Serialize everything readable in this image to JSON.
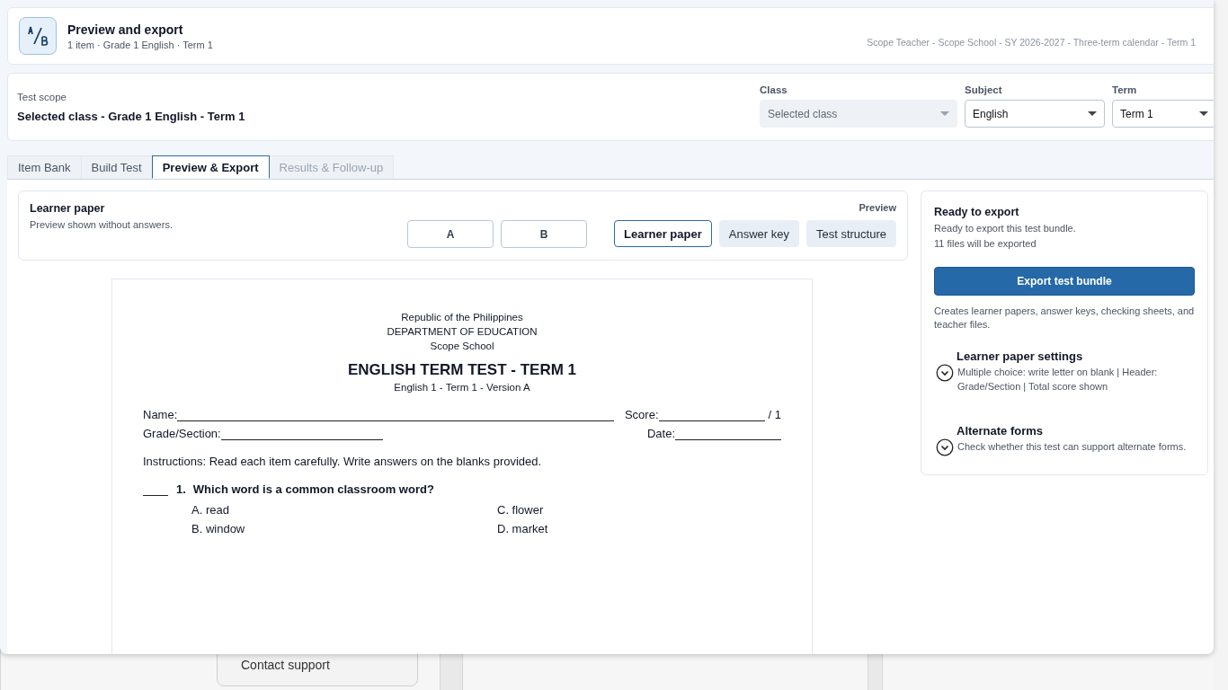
{
  "background": {
    "texts": [
      {
        "kind": "button",
        "text": "Contact support"
      }
    ]
  },
  "header": {
    "title": "Preview and export",
    "subtitle": "1 item · Grade 1 English · Term 1",
    "context": "Scope Teacher - Scope School - SY 2026-2027 - Three-term calendar - Term 1"
  },
  "scope": {
    "label": "Test scope",
    "value": "Selected class - Grade 1 English - Term 1",
    "fields": [
      {
        "label": "Class",
        "value": "Selected class",
        "disabled": true
      },
      {
        "label": "Subject",
        "value": "English",
        "disabled": false
      },
      {
        "label": "Term",
        "value": "Term 1",
        "disabled": false
      }
    ]
  },
  "tabs": [
    {
      "label": "Item Bank",
      "selected": false,
      "disabled": false
    },
    {
      "label": "Build Test",
      "selected": false,
      "disabled": false
    },
    {
      "label": "Preview & Export",
      "selected": true,
      "disabled": false
    },
    {
      "label": "Results & Follow-up",
      "selected": false,
      "disabled": true
    }
  ],
  "preview_bar": {
    "title": "Learner paper",
    "description": "Preview shown without answers.",
    "mode_label": "Preview",
    "versions": [
      {
        "label": "A",
        "selected": false
      },
      {
        "label": "B",
        "selected": false
      }
    ],
    "views": [
      {
        "label": "Learner paper",
        "selected": true
      },
      {
        "label": "Answer key",
        "selected": false
      },
      {
        "label": "Test structure",
        "selected": false
      }
    ]
  },
  "document": {
    "header_lines": [
      "Republic of the Philippines",
      "DEPARTMENT OF EDUCATION",
      "Scope School"
    ],
    "title": "ENGLISH TERM TEST - TERM 1",
    "subtitle": "English 1 - Term 1 - Version A",
    "name_label": "Name:",
    "score_label": "Score:",
    "score_total": "/ 1",
    "grade_label": "Grade/Section:",
    "date_label": "Date:",
    "instructions": "Instructions: Read each item carefully. Write answers on the blanks provided.",
    "questions": [
      {
        "number": "1.",
        "text": "Which word is a common classroom word?",
        "choices": [
          "A. read",
          "B. window",
          "C. flower",
          "D. market"
        ]
      }
    ]
  },
  "export_panel": {
    "title": "Ready to export",
    "status": "Ready to export this test bundle.",
    "count": "11 files will be exported",
    "button": "Export test bundle",
    "note": "Creates learner papers, answer keys, checking sheets, and teacher files.",
    "sections": [
      {
        "title": "Learner paper settings",
        "description": "Multiple choice: write letter on blank | Header: Grade/Section | Total score shown",
        "expanded": false
      },
      {
        "title": "Alternate forms",
        "description": "Check whether this test can support alternate forms.",
        "expanded": false
      }
    ]
  }
}
